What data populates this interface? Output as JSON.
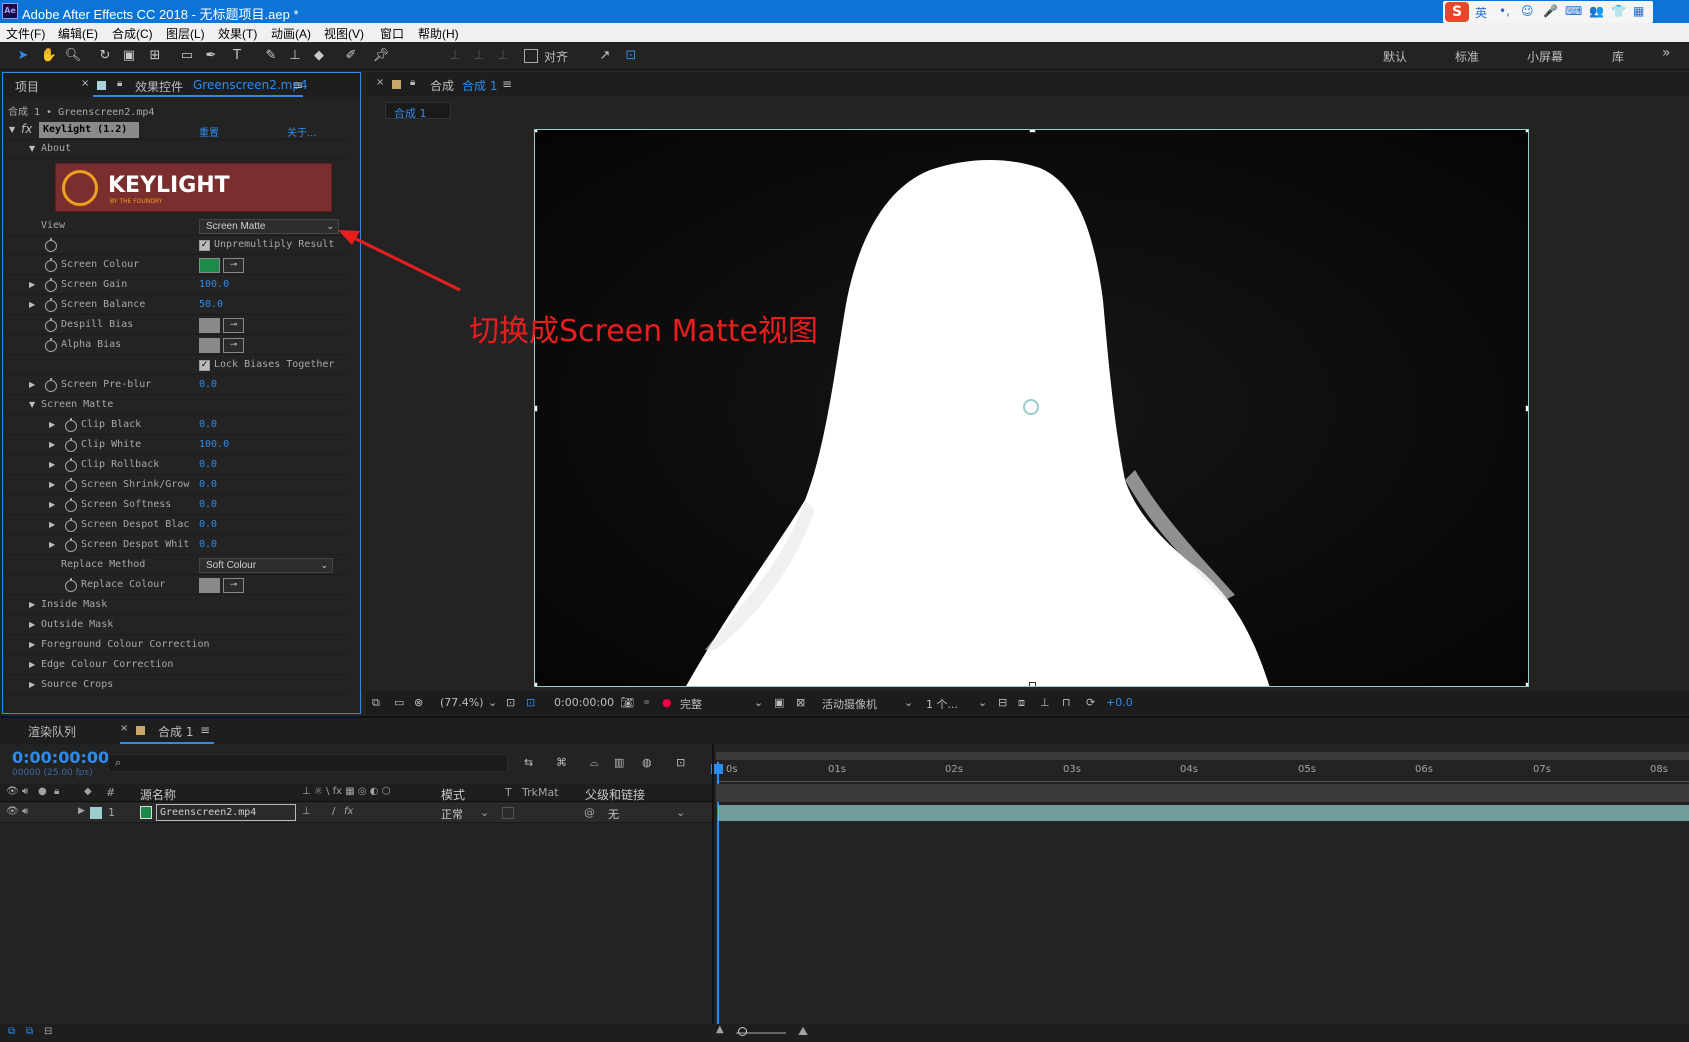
{
  "window": {
    "app_icon": "Ae",
    "title": "Adobe After Effects CC 2018 - 无标题项目.aep *"
  },
  "ime": {
    "items": [
      "英",
      "•,",
      "☺",
      "🎤",
      "⌨",
      "👥",
      "👕",
      "▦"
    ]
  },
  "menu": [
    "文件(F)",
    "编辑(E)",
    "合成(C)",
    "图层(L)",
    "效果(T)",
    "动画(A)",
    "视图(V)",
    "窗口",
    "帮助(H)"
  ],
  "toolbar": {
    "snap_label": "对齐",
    "workspaces": [
      "默认",
      "标准",
      "小屏幕",
      "库"
    ],
    "overflow": "»"
  },
  "effects_panel": {
    "tab_project": "项目",
    "tab_effects": "效果控件",
    "tab_effects_file": "Greenscreen2.mp4",
    "breadcrumb": "合成 1 • Greenscreen2.mp4",
    "effect_name": "Keylight (1.2)",
    "reset": "重置",
    "about": "关于...",
    "about_group": "About",
    "logo_text": "KEYLIGHT",
    "logo_sub": "BY THE FOUNDRY",
    "view_label": "View",
    "view_value": "Screen Matte",
    "unpremultiply": "Unpremultiply Result",
    "params": [
      {
        "label": "Screen Colour",
        "type": "color"
      },
      {
        "label": "Screen Gain",
        "value": "100.0"
      },
      {
        "label": "Screen Balance",
        "value": "50.0"
      },
      {
        "label": "Despill Bias",
        "type": "color"
      },
      {
        "label": "Alpha Bias",
        "type": "color"
      }
    ],
    "lock_biases": "Lock Biases Together",
    "screen_preblur": {
      "label": "Screen Pre-blur",
      "value": "0.0"
    },
    "screen_matte_group": "Screen Matte",
    "matte_params": [
      {
        "label": "Clip Black",
        "value": "0.0"
      },
      {
        "label": "Clip White",
        "value": "100.0"
      },
      {
        "label": "Clip Rollback",
        "value": "0.0"
      },
      {
        "label": "Screen Shrink/Grow",
        "value": "0.0"
      },
      {
        "label": "Screen Softness",
        "value": "0.0"
      },
      {
        "label": "Screen Despot Blac",
        "value": "0.0"
      },
      {
        "label": "Screen Despot Whit",
        "value": "0.0"
      }
    ],
    "replace_method_label": "Replace Method",
    "replace_method_value": "Soft Colour",
    "replace_colour_label": "Replace Colour",
    "groups": [
      "Inside Mask",
      "Outside Mask",
      "Foreground Colour Correction",
      "Edge Colour Correction",
      "Source Crops"
    ],
    "colors": {
      "screen_colour": "#1e8a4a",
      "gray_chip": "#8a8a8a",
      "logo_bg": "#7a2e2e",
      "logo_accent": "#f0a020"
    }
  },
  "viewer": {
    "tab_prefix": "合成",
    "tab_name": "合成 1",
    "subtab": "合成 1",
    "zoom": "(77.4%)",
    "timecode": "0:00:00:00",
    "quality": "完整",
    "camera": "活动摄像机",
    "views": "1 个...",
    "exposure": "+0.0"
  },
  "annotation": "切换成Screen Matte视图",
  "timeline": {
    "tab_render": "渲染队列",
    "tab_comp": "合成 1",
    "timecode": "0:00:00:00",
    "frames": "00000 (25.00 fps)",
    "col_num": "#",
    "col_source": "源名称",
    "col_mode": "模式",
    "col_t": "T",
    "col_trkmat": "TrkMat",
    "col_parent": "父级和链接",
    "ruler": [
      "0s",
      "01s",
      "02s",
      "03s",
      "04s",
      "05s",
      "06s",
      "07s",
      "08s"
    ],
    "layer": {
      "index": "1",
      "name": "Greenscreen2.mp4",
      "mode": "正常",
      "parent": "无"
    },
    "layer_color": "#7fb3b0"
  }
}
